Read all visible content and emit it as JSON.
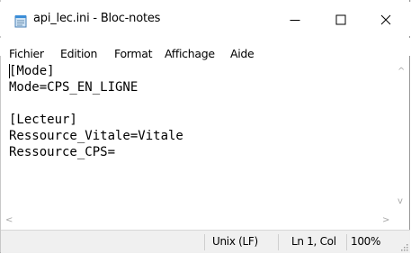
{
  "window": {
    "title": "api_lec.ini - Bloc-notes",
    "controls": {
      "minimize": "—",
      "maximize": "☐",
      "close": "✕"
    }
  },
  "menubar": {
    "items": [
      {
        "label": "Fichier"
      },
      {
        "label": "Edition"
      },
      {
        "label": "Format"
      },
      {
        "label": "Affichage"
      },
      {
        "label": "Aide"
      }
    ]
  },
  "editor": {
    "lines": [
      "[Mode]",
      "Mode=CPS_EN_LIGNE",
      "",
      "[Lecteur]",
      "Ressource_Vitale=Vitale",
      "Ressource_CPS="
    ]
  },
  "scrollbars": {
    "up_arrow": "^",
    "down_arrow": "v",
    "left_arrow": "<",
    "right_arrow": ">"
  },
  "statusbar": {
    "line_ending": "Unix (LF)",
    "position": "Ln 1, Col",
    "zoom": "100%"
  }
}
